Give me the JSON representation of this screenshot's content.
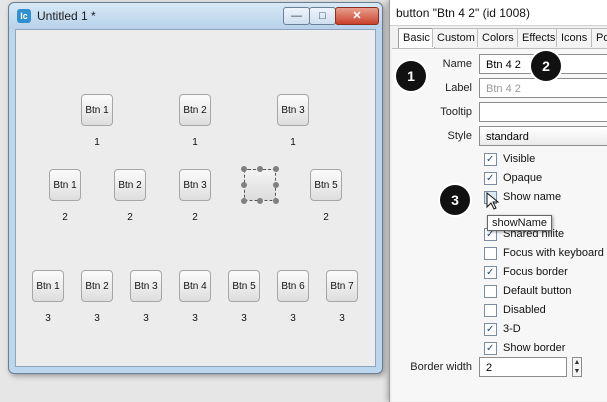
{
  "window": {
    "title": "Untitled 1 *",
    "app_icon": "lc",
    "controls": {
      "minimize": "—",
      "maximize": "□",
      "close": "✕"
    }
  },
  "buttons": {
    "btn_1_1": "Btn 1 1",
    "btn_2_1": "Btn 2 1",
    "btn_3_1": "Btn 3 1",
    "btn_1_2": "Btn 1 2",
    "btn_2_2": "Btn 2 2",
    "btn_3_2": "Btn 3 2",
    "btn_5_2": "Btn 5 2",
    "btn_1_3": "Btn 1 3",
    "btn_2_3": "Btn 2 3",
    "btn_3_3": "Btn 3 3",
    "btn_4_3": "Btn 4 3",
    "btn_5_3": "Btn 5 3",
    "btn_6_3": "Btn 6 3",
    "btn_7_3": "Btn 7 3"
  },
  "inspector": {
    "title": "button \"Btn 4 2\" (id 1008)",
    "tabs": [
      "Basic",
      "Custom",
      "Colors",
      "Effects",
      "Icons",
      "Po"
    ],
    "name_label": "Name",
    "name_value": "Btn 4 2",
    "label_label": "Label",
    "label_value": "Btn 4 2",
    "tooltip_label": "Tooltip",
    "tooltip_value": "",
    "style_label": "Style",
    "style_value": "standard",
    "checkboxes": [
      {
        "label": "Visible",
        "checked": true
      },
      {
        "label": "Opaque",
        "checked": true
      },
      {
        "label": "Show name",
        "checked": false
      },
      {
        "label": "Shared hilite",
        "checked": true
      },
      {
        "label": "Focus with keyboard",
        "checked": false
      },
      {
        "label": "Focus border",
        "checked": true
      },
      {
        "label": "Default button",
        "checked": false
      },
      {
        "label": "Disabled",
        "checked": false
      },
      {
        "label": "3-D",
        "checked": true
      },
      {
        "label": "Show border",
        "checked": true
      }
    ],
    "border_width_label": "Border width",
    "border_width_value": "2",
    "hover_tooltip": "showName"
  },
  "markers": [
    "1",
    "2",
    "3"
  ]
}
